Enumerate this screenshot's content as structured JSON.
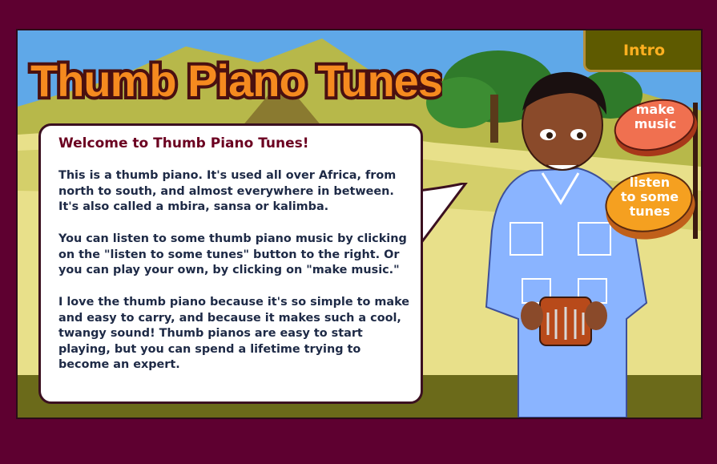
{
  "title": "Thumb Piano Tunes",
  "intro_tab": "Intro",
  "bubble": {
    "heading": "Welcome to Thumb Piano Tunes!",
    "paragraphs": [
      "This is a thumb piano. It's used all over Africa, from north to south, and almost everywhere in between.  It's also called a mbira, sansa or kalimba.",
      "You can listen to some thumb piano music by clicking on the \"listen to some tunes\" button to the right.  Or you can play your own, by clicking on \"make music.\"",
      "I love the thumb piano because it's so simple to make and easy to carry, and because it makes such a cool, twangy sound!  Thumb pianos are easy to start playing, but you can spend a lifetime trying to become an expert."
    ]
  },
  "buttons": {
    "make_music": [
      "make",
      "music"
    ],
    "listen": [
      "listen",
      "to some",
      "tunes"
    ]
  },
  "colors": {
    "frame": "#5e0030",
    "title_fill": "#f58a1f",
    "heading": "#6b0020",
    "body_text": "#1e2a46",
    "intro_text": "#ffb020",
    "make_music_button": "#f07050",
    "listen_button": "#f5a020"
  }
}
